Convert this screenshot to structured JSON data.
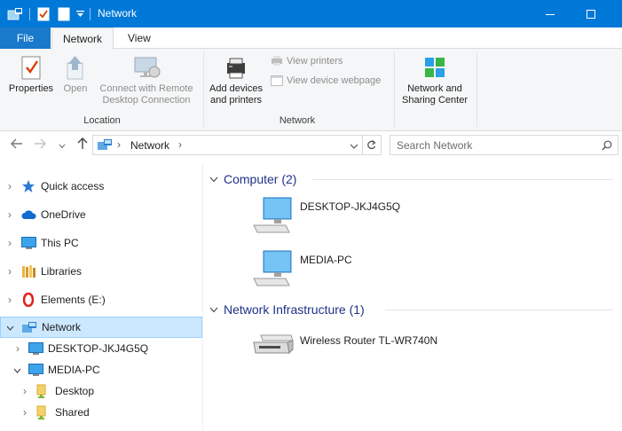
{
  "window": {
    "title": "Network"
  },
  "ribbon": {
    "tabs": {
      "file": "File",
      "network": "Network",
      "view": "View"
    },
    "location_group": {
      "label": "Location",
      "properties": "Properties",
      "open": "Open",
      "remote_line1": "Connect with Remote",
      "remote_line2": "Desktop Connection"
    },
    "network_group": {
      "label": "Network",
      "add_devices_line1": "Add devices",
      "add_devices_line2": "and printers",
      "view_printers": "View printers",
      "view_device_webpage": "View device webpage"
    },
    "sharing": {
      "line1": "Network and",
      "line2": "Sharing Center"
    }
  },
  "address": {
    "path": "Network",
    "separator": "›",
    "search_placeholder": "Search Network"
  },
  "nav_pane": {
    "items": [
      {
        "label": "Quick access"
      },
      {
        "label": "OneDrive"
      },
      {
        "label": "This PC"
      },
      {
        "label": "Libraries"
      },
      {
        "label": "Elements (E:)"
      },
      {
        "label": "Network"
      },
      {
        "label": "DESKTOP-JKJ4G5Q"
      },
      {
        "label": "MEDIA-PC"
      },
      {
        "label": "Desktop"
      },
      {
        "label": "Shared"
      }
    ]
  },
  "content": {
    "groups": [
      {
        "header": "Computer (2)",
        "items": [
          {
            "label": "DESKTOP-JKJ4G5Q"
          },
          {
            "label": "MEDIA-PC"
          }
        ]
      },
      {
        "header": "Network Infrastructure (1)",
        "items": [
          {
            "label": "Wireless Router TL-WR740N"
          }
        ]
      }
    ]
  },
  "colors": {
    "title_bar": "#0078d7",
    "file_tab": "#1979ca",
    "selection": "#cce8ff",
    "group_header": "#1e3287"
  }
}
